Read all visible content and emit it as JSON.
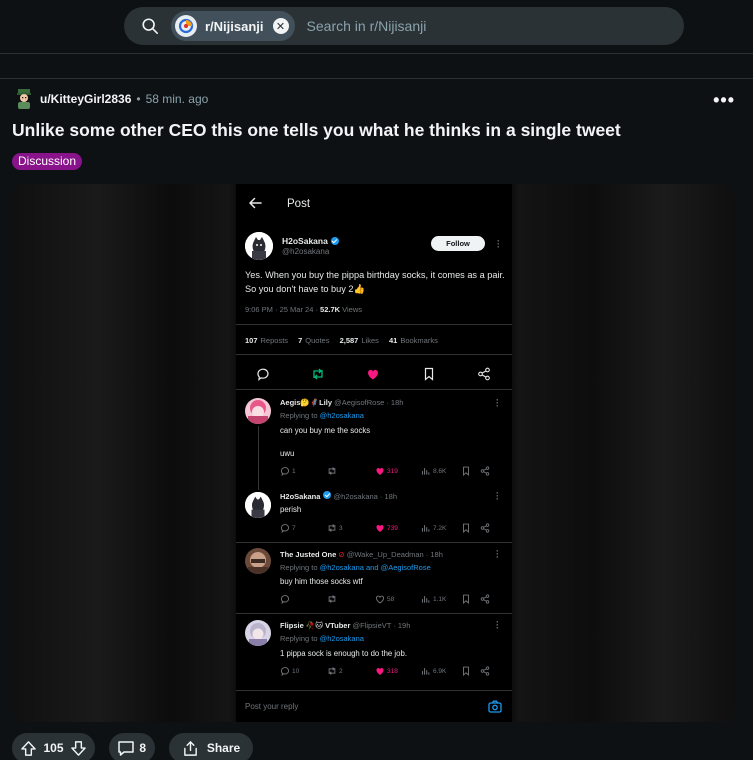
{
  "search": {
    "community_chip": "r/Nijisanji",
    "placeholder": "Search in r/Nijisanji"
  },
  "post": {
    "author": "u/KitteyGirl2836",
    "separator": "•",
    "time": "58 min. ago",
    "title": "Unlike some other CEO this one tells you what he thinks in a single tweet",
    "flair": "Discussion",
    "flair_color": "#88138a"
  },
  "tweet": {
    "header_title": "Post",
    "author_name": "H2oSakana",
    "author_handle": "@h2osakana",
    "follow_label": "Follow",
    "text": "Yes. When you buy the pippa birthday socks, it comes as a pair. So you don't have to buy 2👍",
    "meta_time": "9:06 PM · 25 Mar 24 · ",
    "views_count": "52.7K",
    "views_label": " Views",
    "stats": [
      {
        "count": "107",
        "label": "Reposts"
      },
      {
        "count": "7",
        "label": "Quotes"
      },
      {
        "count": "2,587",
        "label": "Likes"
      },
      {
        "count": "41",
        "label": "Bookmarks"
      }
    ],
    "replies": [
      {
        "name": "Aegis🤔🦸Lily",
        "handle": "@AegisofRose · 18h",
        "replying_prefix": "Replying to ",
        "replying_to": "@h2osakana",
        "text": "can you buy me the socks",
        "text2": "uwu",
        "replies": "1",
        "reposts": "",
        "likes": "319",
        "views": "8.6K"
      },
      {
        "name": "H2oSakana",
        "handle": "@h2osakana · 18h",
        "text": "perish",
        "replies": "7",
        "reposts": "3",
        "likes": "739",
        "views": "7.2K"
      },
      {
        "name": "The Justed One",
        "handle": "@Wake_Up_Deadman · 18h",
        "replying_prefix": "Replying to ",
        "replying_to": "@h2osakana and @AegisofRose",
        "text": "buy him those socks wtf",
        "replies": "",
        "reposts": "",
        "likes": "58",
        "views": "1.1K"
      },
      {
        "name": "Flipsie 🥀🐱 VTuber",
        "handle": "@FlipsieVT · 19h",
        "replying_prefix": "Replying to ",
        "replying_to": "@h2osakana",
        "text": "1 pippa sock is enough to do the job.",
        "replies": "10",
        "reposts": "2",
        "likes": "318",
        "views": "6.9K"
      }
    ],
    "compose_placeholder": "Post your reply",
    "like_color": "#f91880",
    "repost_color": "#00ba7c",
    "link_color": "#1d9bf0"
  },
  "actions": {
    "votes": "105",
    "comments": "8",
    "share_label": "Share"
  }
}
